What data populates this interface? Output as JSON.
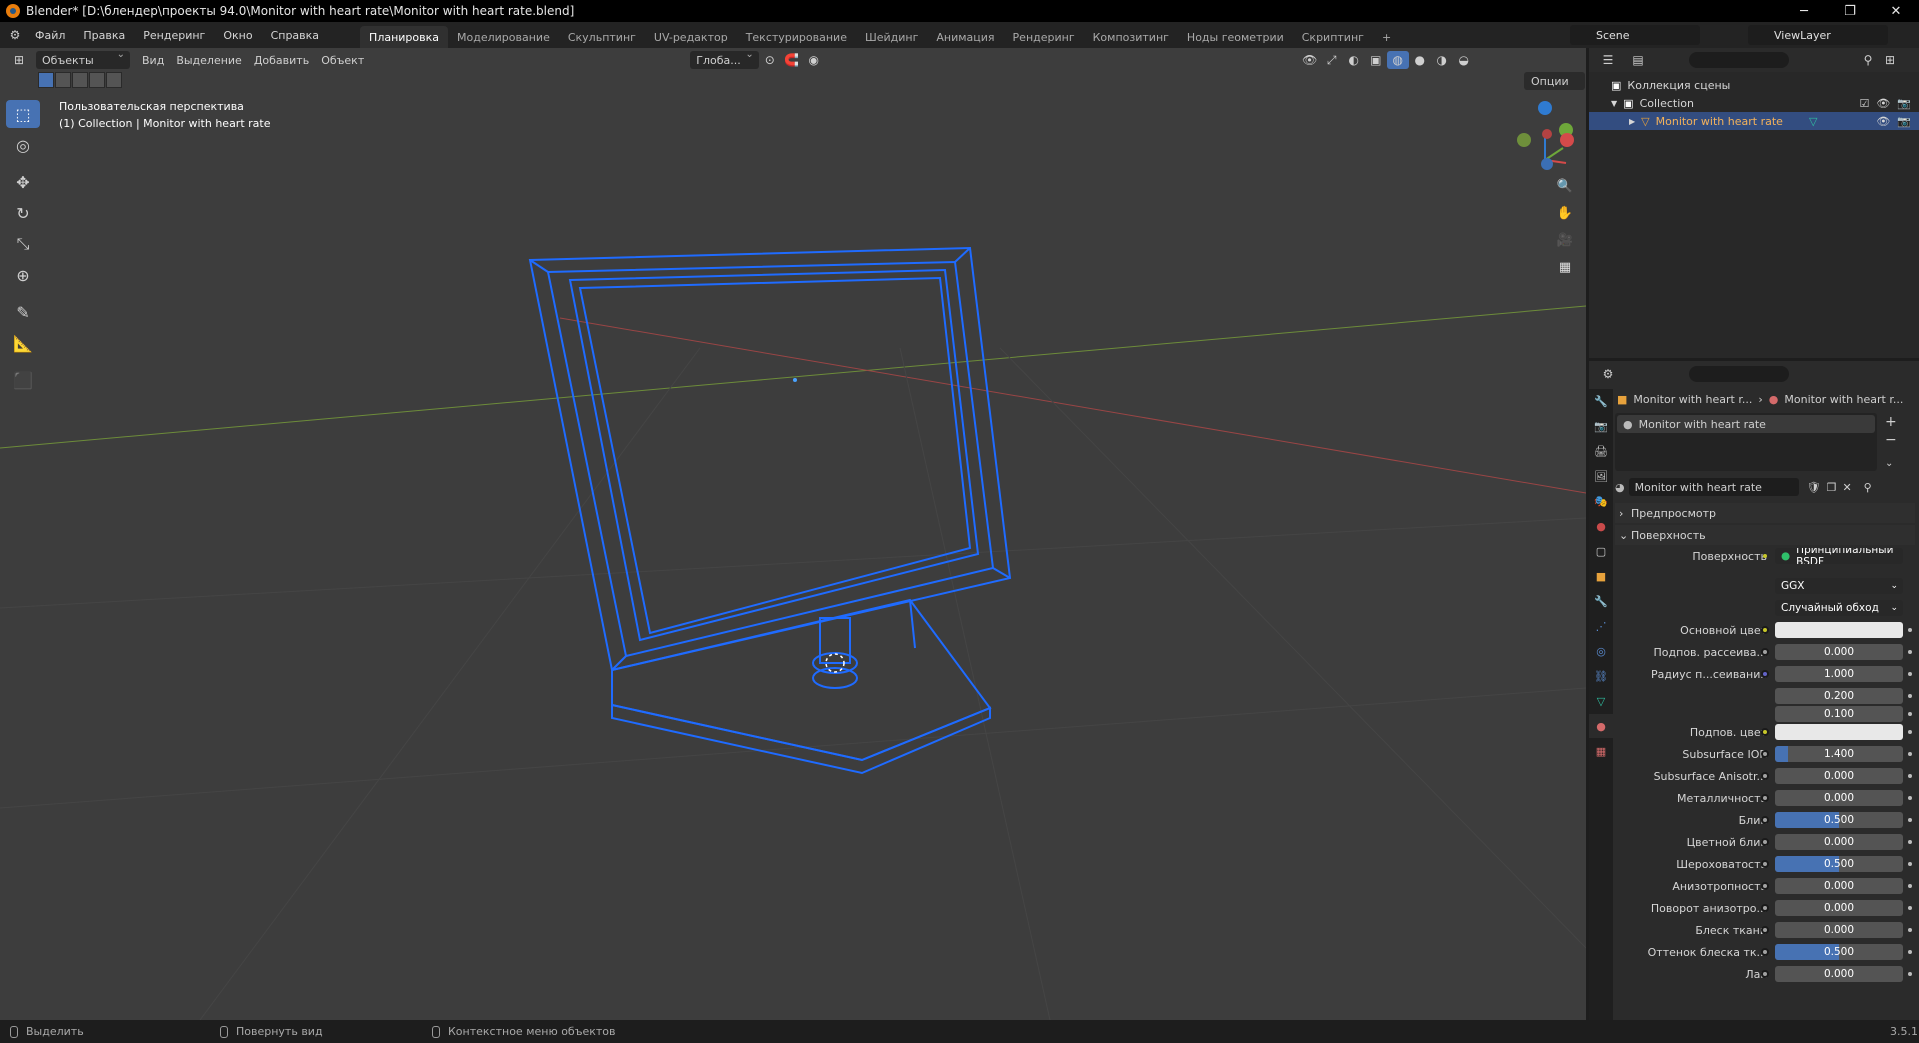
{
  "window": {
    "title": "Blender* [D:\\блендер\\проекты 94.0\\Monitor with heart rate\\Monitor with heart rate.blend]"
  },
  "menu": [
    "Файл",
    "Правка",
    "Рендеринг",
    "Окно",
    "Справка"
  ],
  "workspaces": [
    "Планировка",
    "Моделирование",
    "Скульптинг",
    "UV-редактор",
    "Текстурирование",
    "Шейдинг",
    "Анимация",
    "Рендеринг",
    "Композитинг",
    "Ноды геометрии",
    "Скриптинг"
  ],
  "workspace_active": "Планировка",
  "scene": {
    "name": "Scene",
    "view_layer": "ViewLayer"
  },
  "viewport": {
    "mode": "Объекты",
    "menus": [
      "Вид",
      "Выделение",
      "Добавить",
      "Объект"
    ],
    "transform_orientation": "Глоба...",
    "options_label": "Опции",
    "view_name": "Пользовательская перспектива",
    "collection_info": "(1) Collection | Monitor with heart rate",
    "wire_color": "#1f6bff"
  },
  "outliner": {
    "root": "Коллекция сцены",
    "collection": "Collection",
    "object": "Monitor with heart rate"
  },
  "properties": {
    "breadcrumb_object": "Monitor with heart r...",
    "breadcrumb_material": "Monitor with heart r...",
    "material_slot": "Monitor with heart rate",
    "material_name": "Monitor with heart rate",
    "panel_preview": "Предпросмотр",
    "panel_surface": "Поверхность",
    "surface_label": "Поверхность",
    "surface_value": "Принципиальный BSDF",
    "distribution": "GGX",
    "subsurface_method": "Случайный обход",
    "rows": [
      {
        "label": "Основной цвет",
        "value": "",
        "kind": "color",
        "socket": "yellow"
      },
      {
        "label": "Подпов. рассеива...",
        "value": "0.000",
        "kind": "num",
        "socket": "grey",
        "fill": 0
      },
      {
        "label": "Радиус п...сеивания",
        "value": "1.000",
        "kind": "num",
        "socket": "blue",
        "fill": 0
      },
      {
        "label": "",
        "value": "0.200",
        "kind": "num",
        "socket": "",
        "fill": 0
      },
      {
        "label": "",
        "value": "0.100",
        "kind": "num",
        "socket": "",
        "fill": 0
      },
      {
        "label": "Подпов. цвет",
        "value": "",
        "kind": "color",
        "socket": "yellow"
      },
      {
        "label": "Subsurface IOR",
        "value": "1.400",
        "kind": "num",
        "socket": "grey",
        "fill": 0.1
      },
      {
        "label": "Subsurface Anisotr...",
        "value": "0.000",
        "kind": "num",
        "socket": "grey",
        "fill": 0
      },
      {
        "label": "Металличность",
        "value": "0.000",
        "kind": "num",
        "socket": "grey",
        "fill": 0
      },
      {
        "label": "Блик",
        "value": "0.500",
        "kind": "num",
        "socket": "grey",
        "fill": 0.5
      },
      {
        "label": "Цветной блик",
        "value": "0.000",
        "kind": "num",
        "socket": "grey",
        "fill": 0
      },
      {
        "label": "Шероховатость",
        "value": "0.500",
        "kind": "num",
        "socket": "grey",
        "fill": 0.5
      },
      {
        "label": "Анизотропность",
        "value": "0.000",
        "kind": "num",
        "socket": "grey",
        "fill": 0
      },
      {
        "label": "Поворот анизотро...",
        "value": "0.000",
        "kind": "num",
        "socket": "grey",
        "fill": 0
      },
      {
        "label": "Блеск ткани",
        "value": "0.000",
        "kind": "num",
        "socket": "grey",
        "fill": 0
      },
      {
        "label": "Оттенок блеска тк...",
        "value": "0.500",
        "kind": "num",
        "socket": "grey",
        "fill": 0.5
      },
      {
        "label": "Лак",
        "value": "0.000",
        "kind": "num",
        "socket": "grey",
        "fill": 0
      }
    ]
  },
  "statusbar": {
    "select": "Выделить",
    "rotate": "Повернуть вид",
    "context": "Контекстное меню объектов",
    "version": "3.5.1"
  }
}
